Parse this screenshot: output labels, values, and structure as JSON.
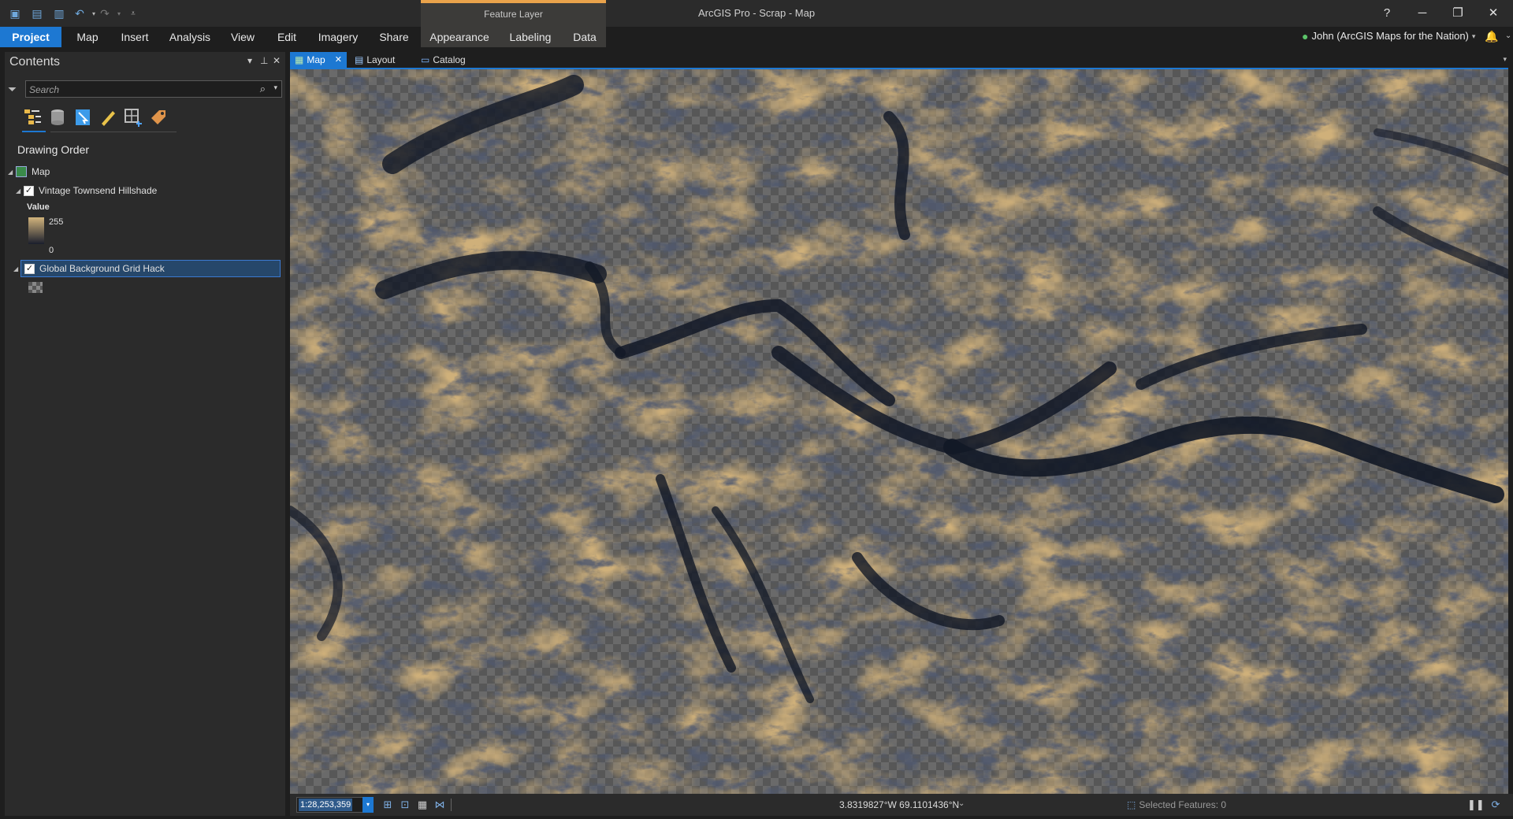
{
  "app": {
    "title": "ArcGIS Pro - Scrap - Map"
  },
  "titlebar": {
    "help": "?",
    "minimize": "─",
    "restore": "❐",
    "close": "✕"
  },
  "context_group": {
    "label": "Feature Layer"
  },
  "ribbon": {
    "tabs": [
      "Project",
      "Map",
      "Insert",
      "Analysis",
      "View",
      "Edit",
      "Imagery",
      "Share",
      "Appearance",
      "Labeling",
      "Data"
    ]
  },
  "account": {
    "name": "John (ArcGIS Maps for the Nation)",
    "caret": "▾"
  },
  "contents": {
    "title": "Contents",
    "search_placeholder": "Search",
    "drawing_order_label": "Drawing Order",
    "map_item": "Map",
    "layers": [
      {
        "name": "Vintage Townsend Hillshade",
        "checked": true,
        "legend_title": "Value",
        "legend_high": "255",
        "legend_low": "0"
      },
      {
        "name": "Global Background Grid Hack",
        "checked": true,
        "selected": true
      }
    ]
  },
  "view_tabs": [
    {
      "label": "Map",
      "active": true,
      "icon": "map-icon"
    },
    {
      "label": "Layout",
      "active": false,
      "icon": "layout-icon"
    },
    {
      "label": "Catalog",
      "active": false,
      "icon": "catalog-icon"
    }
  ],
  "status": {
    "scale": "1:28,253,359",
    "coordinates": "3.8319827°W 69.1101436°N",
    "selected_features": "Selected Features: 0"
  },
  "colors": {
    "accent": "#1d78d2",
    "context_tab": "#e9a24b",
    "terrain_tan": "#d2b47c",
    "terrain_dark": "#1a2030"
  }
}
